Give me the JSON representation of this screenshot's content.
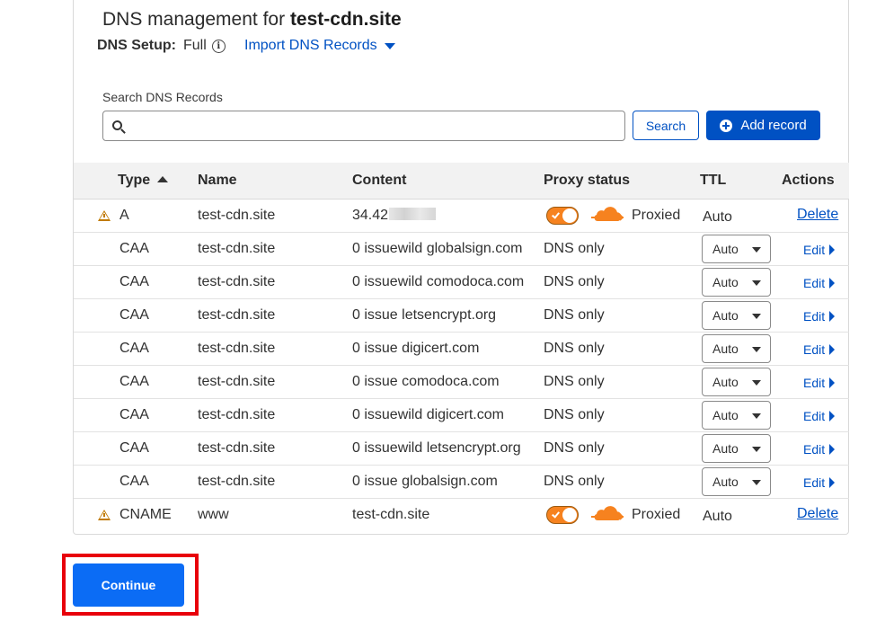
{
  "header": {
    "title_prefix": "DNS management for ",
    "domain": "test-cdn.site",
    "setup_label": "DNS Setup:",
    "setup_value": "Full",
    "import_label": "Import DNS Records"
  },
  "search": {
    "label": "Search DNS Records",
    "value": "",
    "placeholder": "",
    "search_button": "Search",
    "add_button": "Add record"
  },
  "table": {
    "headers": {
      "type": "Type",
      "name": "Name",
      "content": "Content",
      "proxy": "Proxy status",
      "ttl": "TTL",
      "actions": "Actions"
    },
    "rows": [
      {
        "type": "A",
        "name": "test-cdn.site",
        "content": "34.42",
        "proxy": "Proxied",
        "ttl": "Auto",
        "action": "Delete",
        "warning": true
      },
      {
        "type": "CAA",
        "name": "test-cdn.site",
        "content": "0 issuewild globalsign.com",
        "proxy": "DNS only",
        "ttl": "Auto",
        "action": "Edit"
      },
      {
        "type": "CAA",
        "name": "test-cdn.site",
        "content": "0 issuewild comodoca.com",
        "proxy": "DNS only",
        "ttl": "Auto",
        "action": "Edit"
      },
      {
        "type": "CAA",
        "name": "test-cdn.site",
        "content": "0 issue letsencrypt.org",
        "proxy": "DNS only",
        "ttl": "Auto",
        "action": "Edit"
      },
      {
        "type": "CAA",
        "name": "test-cdn.site",
        "content": "0 issue digicert.com",
        "proxy": "DNS only",
        "ttl": "Auto",
        "action": "Edit"
      },
      {
        "type": "CAA",
        "name": "test-cdn.site",
        "content": "0 issue comodoca.com",
        "proxy": "DNS only",
        "ttl": "Auto",
        "action": "Edit"
      },
      {
        "type": "CAA",
        "name": "test-cdn.site",
        "content": "0 issuewild digicert.com",
        "proxy": "DNS only",
        "ttl": "Auto",
        "action": "Edit"
      },
      {
        "type": "CAA",
        "name": "test-cdn.site",
        "content": "0 issuewild letsencrypt.org",
        "proxy": "DNS only",
        "ttl": "Auto",
        "action": "Edit"
      },
      {
        "type": "CAA",
        "name": "test-cdn.site",
        "content": "0 issue globalsign.com",
        "proxy": "DNS only",
        "ttl": "Auto",
        "action": "Edit"
      },
      {
        "type": "CNAME",
        "name": "www",
        "content": "test-cdn.site",
        "proxy": "Proxied",
        "ttl": "Auto",
        "action": "Delete",
        "warning": true
      }
    ]
  },
  "footer": {
    "continue_label": "Continue"
  },
  "colors": {
    "accent": "#0051c3",
    "continue": "#0b6cf5",
    "proxy_orange": "#f6821f",
    "highlight": "#e8000b",
    "warning": "#c07a00"
  },
  "icons": [
    "info-icon",
    "caret-down-icon",
    "search-icon",
    "plus-circle-icon",
    "sort-ascending-icon",
    "warning-icon",
    "proxy-toggle",
    "cloud-proxy-icon",
    "select-caret-icon",
    "caret-right-icon"
  ]
}
